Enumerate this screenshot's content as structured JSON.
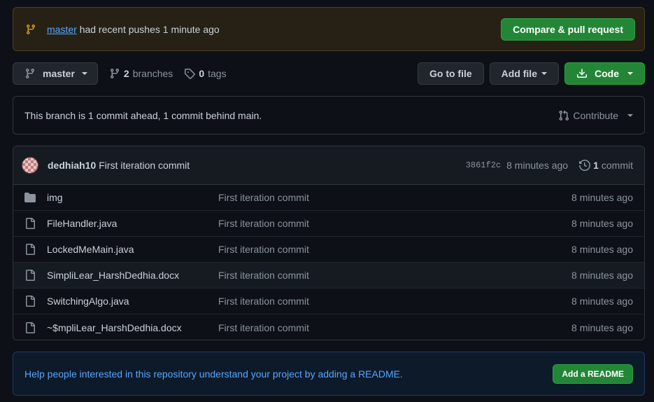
{
  "push_banner": {
    "branch": "master",
    "message": "had recent pushes 1 minute ago",
    "button": "Compare & pull request"
  },
  "toolbar": {
    "branch_button": "master",
    "branches_count": "2",
    "branches_label": "branches",
    "tags_count": "0",
    "tags_label": "tags",
    "go_to_file": "Go to file",
    "add_file": "Add file",
    "code": "Code"
  },
  "ahead_behind": {
    "text": "This branch is 1 commit ahead, 1 commit behind main.",
    "contribute": "Contribute"
  },
  "latest_commit": {
    "author": "dedhiah10",
    "message": "First iteration commit",
    "sha": "3861f2c",
    "time": "8 minutes ago",
    "commit_count": "1",
    "commit_label": "commit"
  },
  "files": [
    {
      "name": "img",
      "type": "dir",
      "message": "First iteration commit",
      "age": "8 minutes ago"
    },
    {
      "name": "FileHandler.java",
      "type": "file",
      "message": "First iteration commit",
      "age": "8 minutes ago"
    },
    {
      "name": "LockedMeMain.java",
      "type": "file",
      "message": "First iteration commit",
      "age": "8 minutes ago"
    },
    {
      "name": "SimpliLear_HarshDedhia.docx",
      "type": "file",
      "message": "First iteration commit",
      "age": "8 minutes ago"
    },
    {
      "name": "SwitchingAlgo.java",
      "type": "file",
      "message": "First iteration commit",
      "age": "8 minutes ago"
    },
    {
      "name": "~$mpliLear_HarshDedhia.docx",
      "type": "file",
      "message": "First iteration commit",
      "age": "8 minutes ago"
    }
  ],
  "readme_banner": {
    "text": "Help people interested in this repository understand your project by adding a README.",
    "button": "Add a README"
  },
  "icons": {
    "branch": "git-branch-icon",
    "tag": "tag-icon",
    "pull_request": "git-pull-request-icon",
    "history": "history-icon",
    "download": "download-icon",
    "folder": "folder-icon",
    "file": "file-icon"
  },
  "colors": {
    "background": "#0d1117",
    "accent_green": "#238636",
    "link_blue": "#58a6ff",
    "warning_yellow": "#d29922"
  }
}
